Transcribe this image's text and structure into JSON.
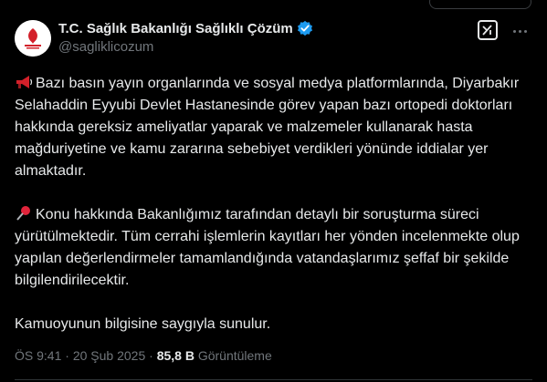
{
  "tweet": {
    "display_name": "T.C. Sağlık Bakanlığı Sağlıklı Çözüm",
    "handle": "@sagliklicozum",
    "paragraphs": [
      {
        "icon": "megaphone-icon",
        "text": "Bazı basın yayın organlarında ve sosyal medya platformlarında, Diyarbakır Selahaddin Eyyubi Devlet Hastanesinde görev yapan bazı ortopedi doktorları hakkında gereksiz ameliyatlar yaparak ve malzemeler kullanarak hasta mağduriyetine ve kamu zararına sebebiyet verdikleri yönünde iddialar yer almaktadır."
      },
      {
        "icon": "pushpin-icon",
        "text": "Konu hakkında Bakanlığımız tarafından detaylı bir soruşturma süreci yürütülmektedir. Tüm cerrahi işlemlerin kayıtları her yönden incelenmekte olup yapılan değerlendirmeler tamamlandığında vatandaşlarımız şeffaf bir şekilde bilgilendirilecektir."
      },
      {
        "icon": "",
        "text": "Kamuoyunun bilgisine saygıyla sunulur."
      }
    ],
    "time": "ÖS 9:41",
    "separator": "·",
    "date": "20 Şub 2025",
    "views_count": "85,8 B",
    "views_label": "Görüntüleme"
  },
  "colors": {
    "background": "#000000",
    "text": "#e7e9ea",
    "muted": "#71767b",
    "verified": "#1d9bf0",
    "logo_red": "#d3202a"
  }
}
